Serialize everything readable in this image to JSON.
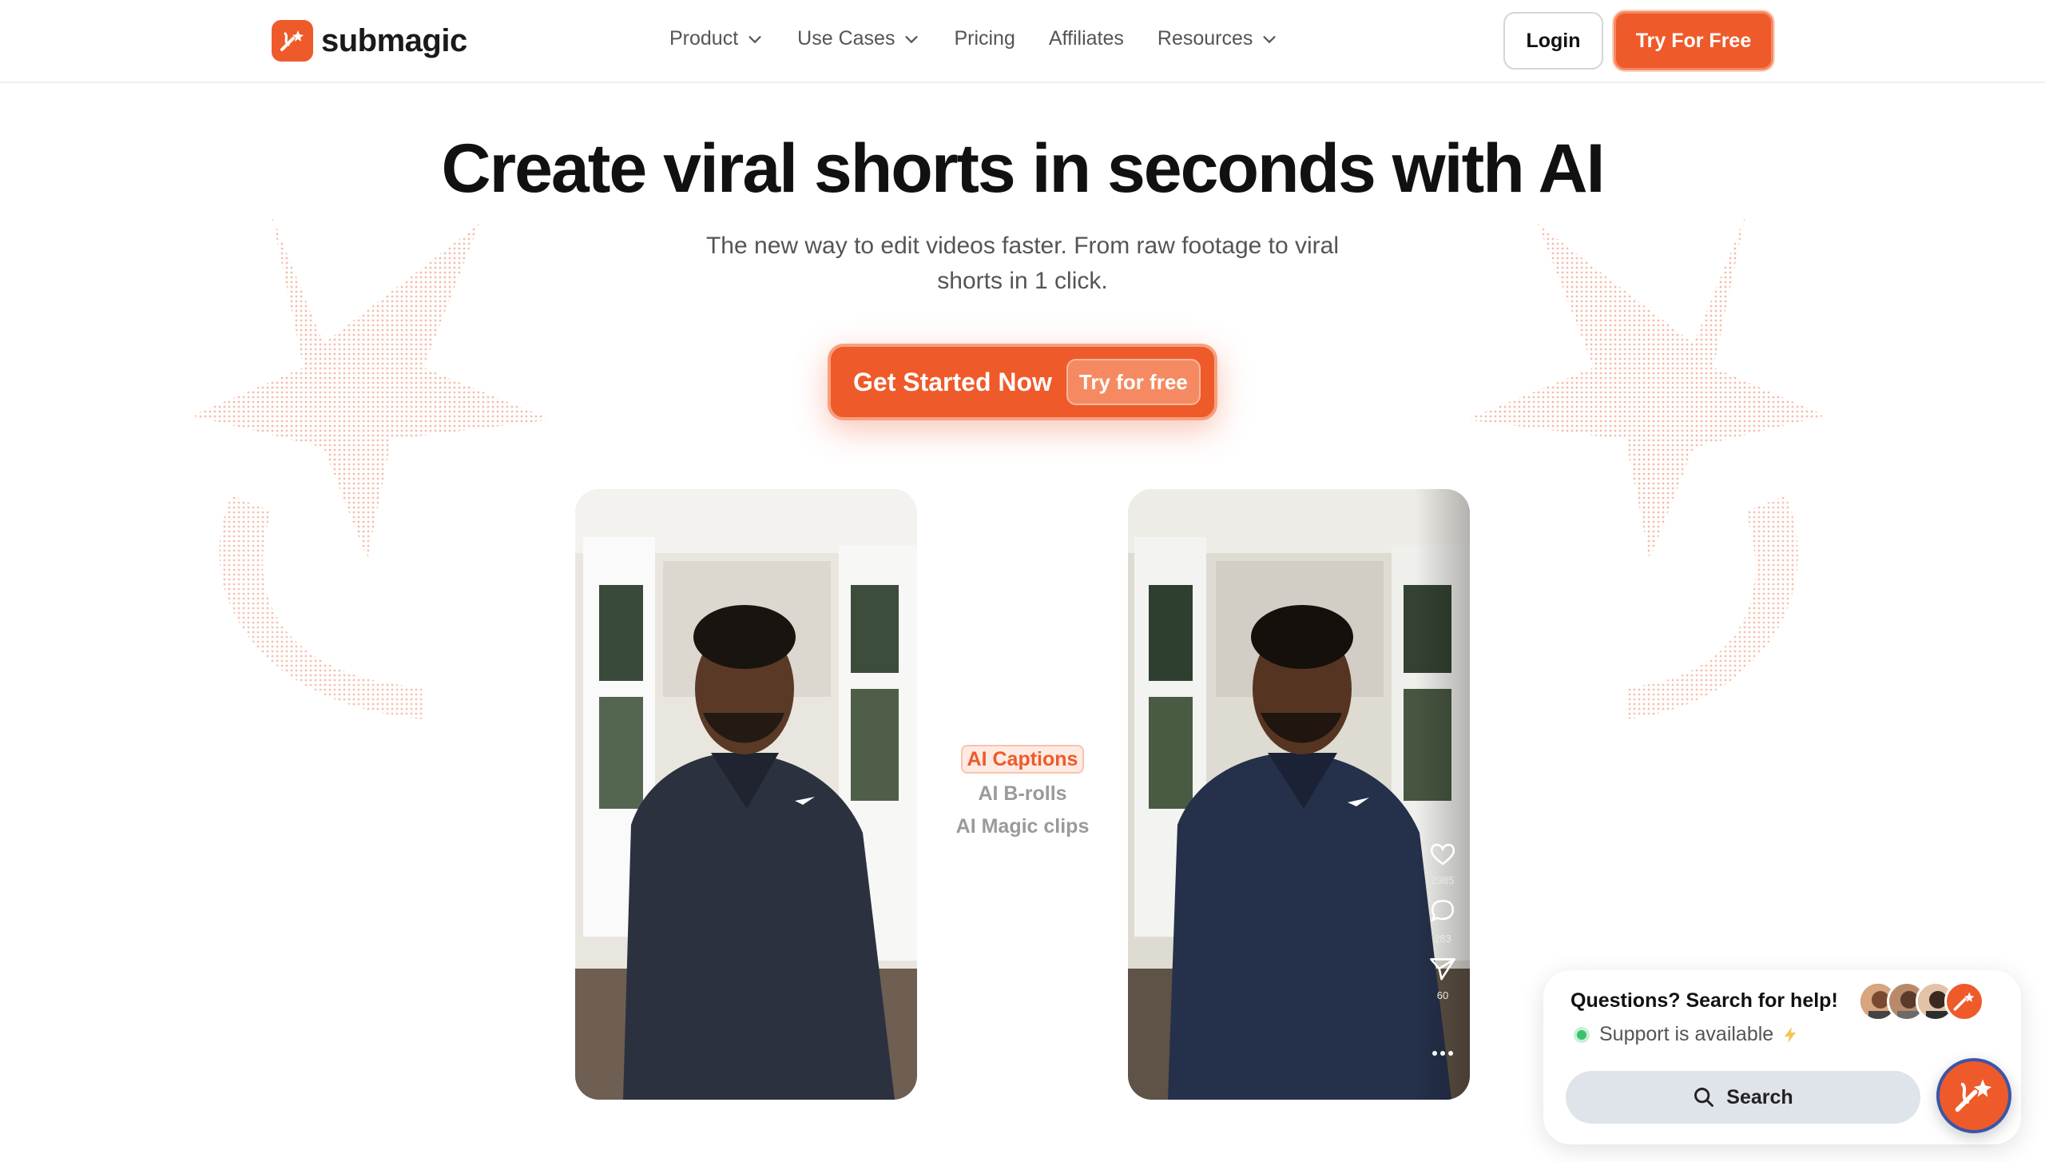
{
  "brand": {
    "name": "submagic",
    "accent": "#ef5a2a"
  },
  "nav": {
    "items": [
      {
        "label": "Product",
        "dropdown": true
      },
      {
        "label": "Use Cases",
        "dropdown": true
      },
      {
        "label": "Pricing",
        "dropdown": false
      },
      {
        "label": "Affiliates",
        "dropdown": false
      },
      {
        "label": "Resources",
        "dropdown": true
      }
    ],
    "login_label": "Login",
    "try_label": "Try For Free"
  },
  "hero": {
    "title": "Create viral shorts in seconds with AI",
    "subtitle": "The new way to edit videos faster. From raw footage to viral shorts in 1 click.",
    "cta_label": "Get Started Now",
    "cta_badge": "Try for free"
  },
  "features": {
    "active": "AI Captions",
    "items": [
      "AI B-rolls",
      "AI Magic clips"
    ]
  },
  "video_right": {
    "likes": "2985",
    "comments": "283",
    "shares": "60"
  },
  "support": {
    "title": "Questions? Search for help!",
    "status": "Support is available",
    "status_icon": "lightning-icon",
    "search_label": "Search"
  }
}
